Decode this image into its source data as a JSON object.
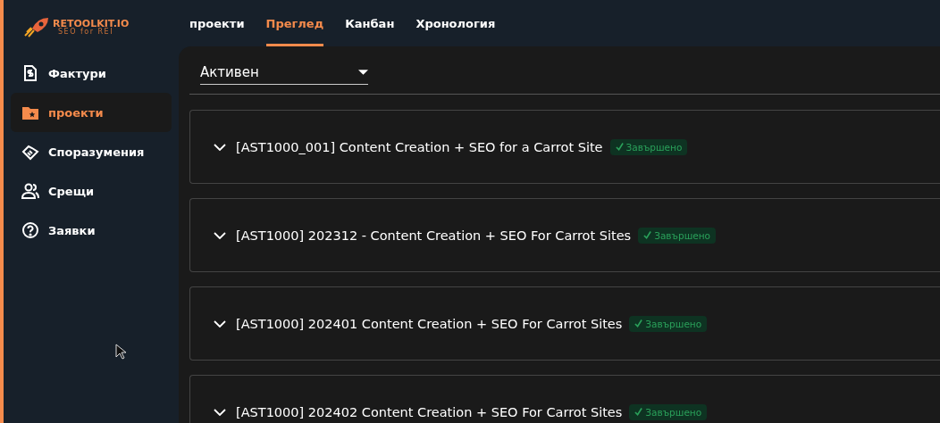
{
  "logo": {
    "name": "RETOOLKIT.IO",
    "tagline": "SEO for REI"
  },
  "tabs": [
    {
      "label": "проекти",
      "selected": false
    },
    {
      "label": "Преглед",
      "selected": true
    },
    {
      "label": "Канбан",
      "selected": false
    },
    {
      "label": "Хронология",
      "selected": false
    }
  ],
  "sidebar": {
    "items": [
      {
        "label": "Фактури",
        "selected": false
      },
      {
        "label": "проекти",
        "selected": true
      },
      {
        "label": "Споразумения",
        "selected": false
      },
      {
        "label": "Срещи",
        "selected": false
      },
      {
        "label": "Заявки",
        "selected": false
      }
    ]
  },
  "filter": {
    "value": "Активен"
  },
  "projects": [
    {
      "title": "[AST1000_001] Content Creation + SEO for a Carrot Site",
      "status": "Завършено",
      "expanded": false
    },
    {
      "title": "[AST1000] 202312 - Content Creation + SEO For Carrot Sites",
      "status": "Завършено",
      "expanded": false
    },
    {
      "title": "[AST1000] 202401 Content Creation + SEO For Carrot Sites",
      "status": "Завършено",
      "expanded": false
    },
    {
      "title": "[AST1000] 202402 Content Creation + SEO For Carrot Sites",
      "status": "Завършено",
      "expanded": false
    }
  ]
}
